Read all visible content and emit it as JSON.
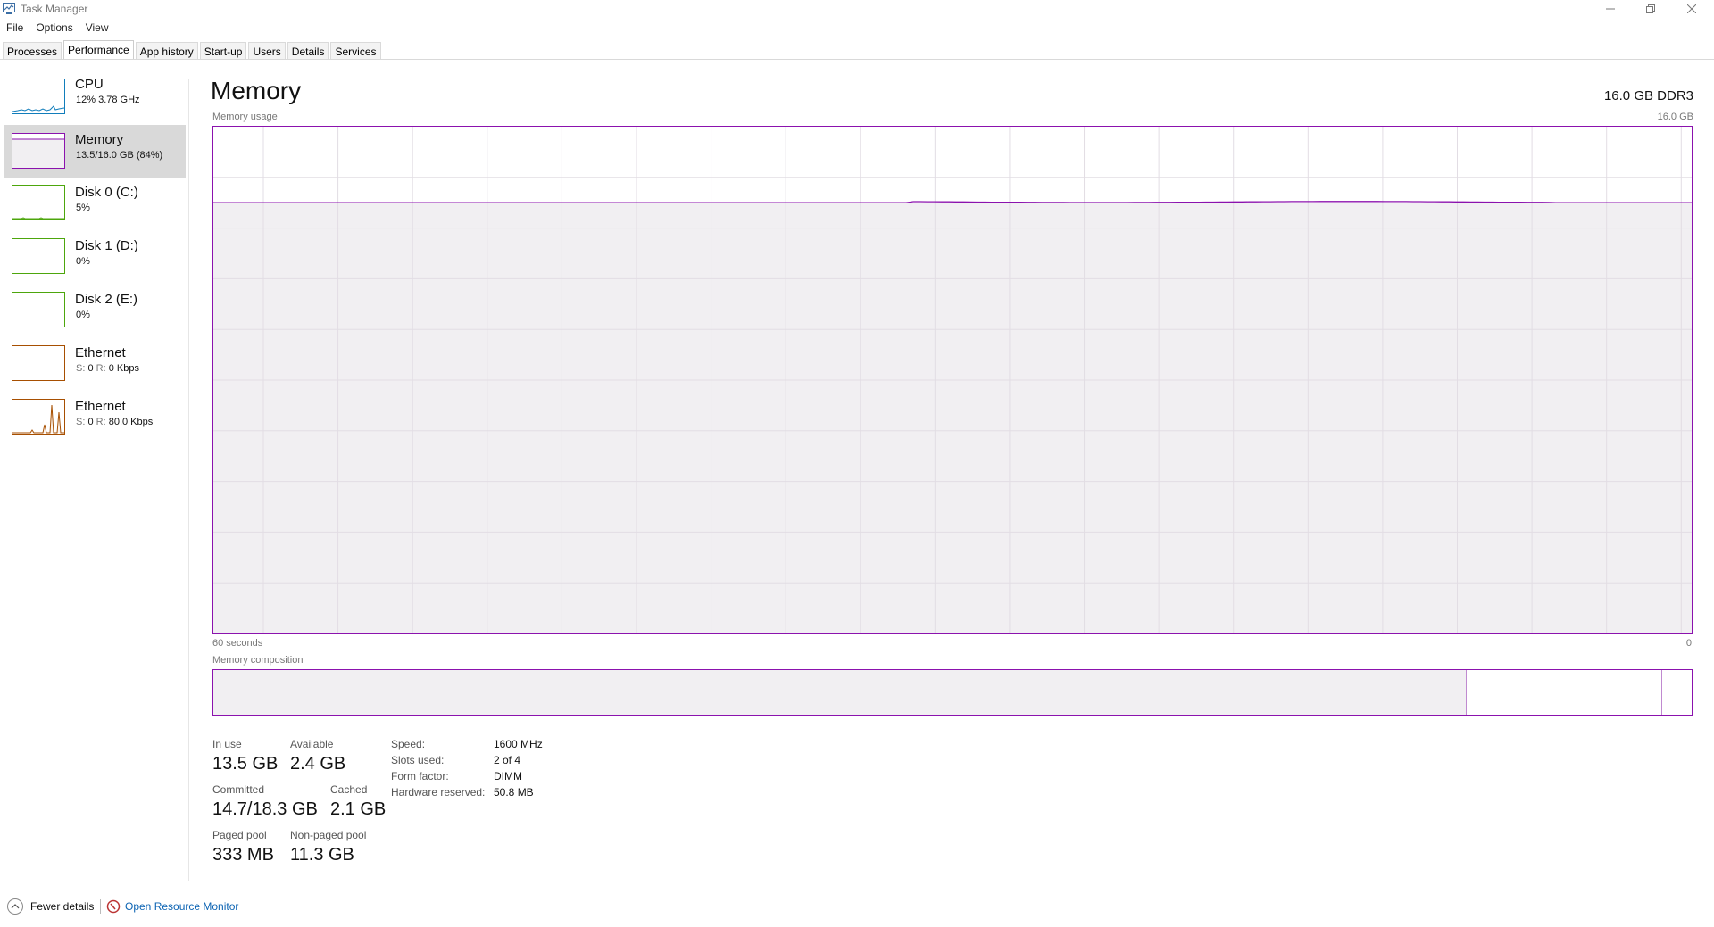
{
  "window": {
    "title": "Task Manager",
    "minimize_icon": "minimize-icon",
    "maximize_icon": "restore-icon",
    "close_icon": "close-icon"
  },
  "menu": [
    "File",
    "Options",
    "View"
  ],
  "tabs": [
    "Processes",
    "Performance",
    "App history",
    "Start-up",
    "Users",
    "Details",
    "Services"
  ],
  "active_tab": "Performance",
  "sidebar": [
    {
      "name": "CPU",
      "sub": "12% 3.78 GHz",
      "color": "#117dbb",
      "active": false
    },
    {
      "name": "Memory",
      "sub": "13.5/16.0 GB (84%)",
      "color": "#8b12ae",
      "active": true
    },
    {
      "name": "Disk 0 (C:)",
      "sub": "5%",
      "color": "#4da60c",
      "active": false
    },
    {
      "name": "Disk 1 (D:)",
      "sub": "0%",
      "color": "#4da60c",
      "active": false
    },
    {
      "name": "Disk 2 (E:)",
      "sub": "0%",
      "color": "#4da60c",
      "active": false
    },
    {
      "name": "Ethernet",
      "sub_s_label": "S:",
      "sub_s": "0",
      "sub_r_label": "R:",
      "sub_r": "0 Kbps",
      "color": "#a74f01",
      "active": false
    },
    {
      "name": "Ethernet",
      "sub_s_label": "S:",
      "sub_s": "0",
      "sub_r_label": "R:",
      "sub_r": "80.0 Kbps",
      "color": "#a74f01",
      "active": false
    }
  ],
  "main": {
    "title": "Memory",
    "spec": "16.0 GB DDR3",
    "usage_label": "Memory usage",
    "usage_max": "16.0 GB",
    "time_left": "60 seconds",
    "time_right": "0",
    "composition_label": "Memory composition",
    "usage_fraction": 0.85,
    "composition": {
      "in_use_fraction": 0.848,
      "modified_fraction": 0.132
    },
    "line_color": "#8b12ae"
  },
  "stats": {
    "in_use_label": "In use",
    "in_use": "13.5 GB",
    "available_label": "Available",
    "available": "2.4 GB",
    "committed_label": "Committed",
    "committed": "14.7/18.3 GB",
    "cached_label": "Cached",
    "cached": "2.1 GB",
    "paged_label": "Paged pool",
    "paged": "333 MB",
    "nonpaged_label": "Non-paged pool",
    "nonpaged": "11.3 GB"
  },
  "details": {
    "speed_label": "Speed:",
    "speed": "1600 MHz",
    "slots_label": "Slots used:",
    "slots": "2 of 4",
    "form_label": "Form factor:",
    "form": "DIMM",
    "reserved_label": "Hardware reserved:",
    "reserved": "50.8 MB"
  },
  "footer": {
    "fewer": "Fewer details",
    "monitor": "Open Resource Monitor"
  }
}
